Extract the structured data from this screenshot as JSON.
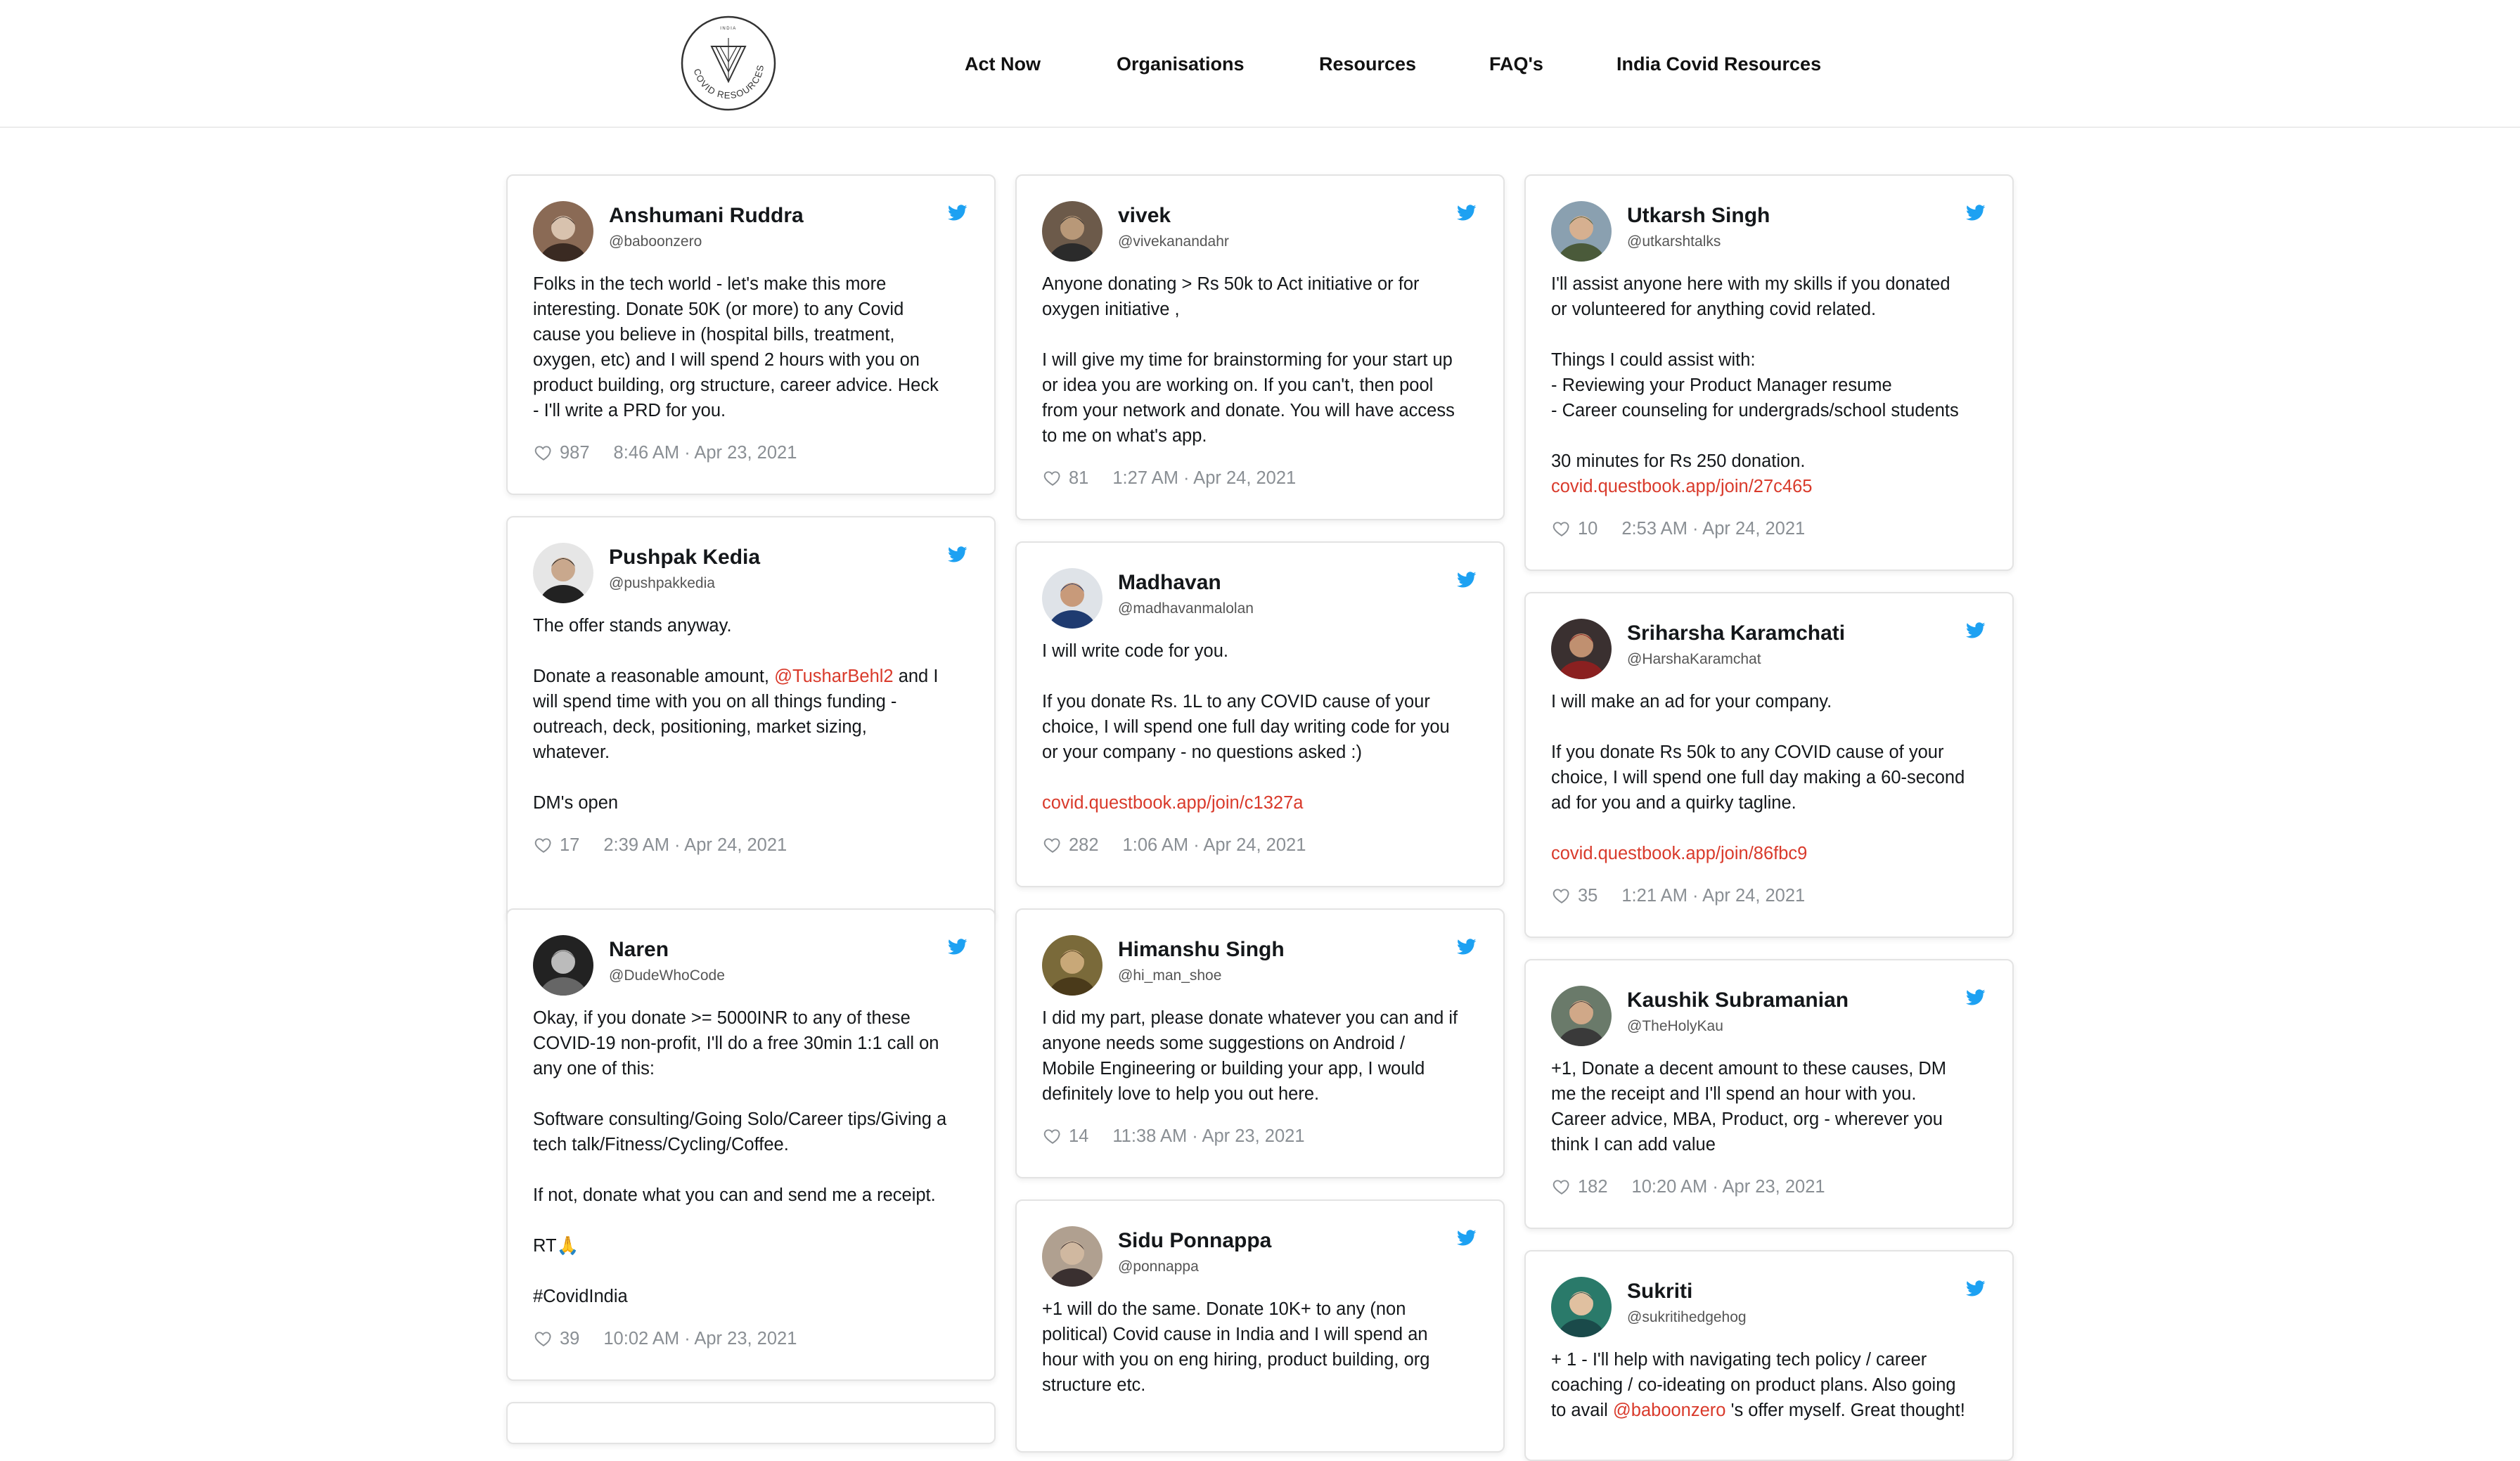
{
  "header": {
    "logo_text_top": "INDIA",
    "logo_text_ring": "COVID RESOURCES",
    "nav": [
      {
        "label": "Act Now"
      },
      {
        "label": "Organisations"
      },
      {
        "label": "Resources"
      },
      {
        "label": "FAQ's"
      },
      {
        "label": "India Covid Resources"
      }
    ]
  },
  "colors": {
    "twitter_blue": "#1da1f2",
    "link_red": "#d93a2b",
    "meta_gray": "#8a8f94"
  },
  "tweets": [
    {
      "name": "Anshumani Ruddra",
      "handle": "@baboonzero",
      "lines": [
        {
          "t": "Folks in the tech world - let's make this more"
        },
        {
          "t": "interesting. Donate 50K (or more) to any Covid"
        },
        {
          "t": "cause you believe in (hospital bills, treatment,"
        },
        {
          "t": "oxygen, etc) and I will spend 2 hours with you on"
        },
        {
          "t": "product building, org structure, career advice. Heck"
        },
        {
          "t": "- I'll write a PRD for you."
        }
      ],
      "likes": "987",
      "time": "8:46 AM · Apr 23, 2021"
    },
    {
      "name": "Pushpak Kedia",
      "handle": "@pushpakkedia",
      "lines": [
        {
          "t": "The offer stands anyway."
        },
        {
          "t": ""
        },
        {
          "t": "Donate a reasonable amount, ",
          "link": "@TusharBehl2",
          "after": " and I"
        },
        {
          "t": "will spend time with you on all things funding -"
        },
        {
          "t": "outreach, deck, positioning, market sizing,"
        },
        {
          "t": "whatever."
        },
        {
          "t": ""
        },
        {
          "t": "DM's open"
        }
      ],
      "likes": "17",
      "time": "2:39 AM · Apr 24, 2021"
    },
    {
      "name": "Naren",
      "handle": "@DudeWhoCode",
      "lines": [
        {
          "t": "Okay, if you donate >= 5000INR to any of these"
        },
        {
          "t": "COVID-19 non-profit, I'll do a free 30min 1:1 call on"
        },
        {
          "t": "any one of this:"
        },
        {
          "t": ""
        },
        {
          "t": "Software consulting/Going Solo/Career tips/Giving a"
        },
        {
          "t": "tech talk/Fitness/Cycling/Coffee."
        },
        {
          "t": ""
        },
        {
          "t": "If not, donate what you can and send me a receipt."
        },
        {
          "t": ""
        },
        {
          "t": "RT🙏"
        },
        {
          "t": ""
        },
        {
          "t": "#CovidIndia"
        }
      ],
      "likes": "39",
      "time": "10:02 AM · Apr 23, 2021"
    },
    {
      "name": "vivek",
      "handle": "@vivekanandahr",
      "lines": [
        {
          "t": "Anyone donating > Rs 50k to Act initiative or for"
        },
        {
          "t": "oxygen initiative ,"
        },
        {
          "t": ""
        },
        {
          "t": "I will give my time for brainstorming for your start up"
        },
        {
          "t": "or idea you are working on. If you can't, then pool"
        },
        {
          "t": "from your network and donate. You will have access"
        },
        {
          "t": "to me on what's app."
        }
      ],
      "likes": "81",
      "time": "1:27 AM · Apr 24, 2021"
    },
    {
      "name": "Madhavan",
      "handle": "@madhavanmalolan",
      "lines": [
        {
          "t": "I will write code for you."
        },
        {
          "t": ""
        },
        {
          "t": "If you donate Rs. 1L to any COVID cause of your"
        },
        {
          "t": "choice, I will spend one full day writing code for you"
        },
        {
          "t": "or your company - no questions asked :)"
        },
        {
          "t": ""
        },
        {
          "t": "",
          "link": "covid.questbook.app/join/c1327a",
          "after": ""
        }
      ],
      "likes": "282",
      "time": "1:06 AM · Apr 24, 2021"
    },
    {
      "name": "Himanshu Singh",
      "handle": "@hi_man_shoe",
      "lines": [
        {
          "t": "I did my part, please donate whatever you can and if"
        },
        {
          "t": "anyone needs some suggestions on Android /"
        },
        {
          "t": "Mobile Engineering or building your app, I would"
        },
        {
          "t": "definitely love to help you out here."
        }
      ],
      "likes": "14",
      "time": "11:38 AM · Apr 23, 2021"
    },
    {
      "name": "Sidu Ponnappa",
      "handle": "@ponnappa",
      "lines": [
        {
          "t": "+1 will do the same. Donate 10K+ to any (non"
        },
        {
          "t": "political) Covid cause in India and I will spend an"
        },
        {
          "t": "hour with you on eng hiring, product building, org"
        },
        {
          "t": "structure etc."
        }
      ],
      "likes": "",
      "time": ""
    },
    {
      "name": "Utkarsh Singh",
      "handle": "@utkarshtalks",
      "lines": [
        {
          "t": "I'll assist anyone here with my skills if you donated"
        },
        {
          "t": "or volunteered for anything covid related."
        },
        {
          "t": ""
        },
        {
          "t": "Things I could assist with:"
        },
        {
          "t": "- Reviewing your Product Manager resume"
        },
        {
          "t": "- Career counseling for undergrads/school students"
        },
        {
          "t": ""
        },
        {
          "t": "30 minutes for Rs 250 donation."
        },
        {
          "t": "",
          "link": "covid.questbook.app/join/27c465",
          "after": ""
        }
      ],
      "likes": "10",
      "time": "2:53 AM · Apr 24, 2021"
    },
    {
      "name": "Sriharsha Karamchati",
      "handle": "@HarshaKaramchat",
      "lines": [
        {
          "t": "I will make an ad for your company."
        },
        {
          "t": ""
        },
        {
          "t": "If you donate Rs 50k to any COVID cause of your"
        },
        {
          "t": "choice, I will spend one full day making a 60-second"
        },
        {
          "t": "ad for you and a quirky tagline."
        },
        {
          "t": ""
        },
        {
          "t": "",
          "link": "covid.questbook.app/join/86fbc9",
          "after": ""
        }
      ],
      "likes": "35",
      "time": "1:21 AM · Apr 24, 2021"
    },
    {
      "name": "Kaushik Subramanian",
      "handle": "@TheHolyKau",
      "lines": [
        {
          "t": "+1, Donate a decent amount to these causes, DM"
        },
        {
          "t": "me the receipt and I'll spend an hour with you."
        },
        {
          "t": "Career advice, MBA, Product, org - wherever you"
        },
        {
          "t": "think I can add value"
        }
      ],
      "likes": "182",
      "time": "10:20 AM · Apr 23, 2021"
    },
    {
      "name": "Sukriti",
      "handle": "@sukritihedgehog",
      "lines": [
        {
          "t": "+ 1 - I'll help with navigating tech policy / career"
        },
        {
          "t": "coaching / co-ideating on product plans. Also going"
        },
        {
          "t": "to avail ",
          "link": "@baboonzero",
          "after": " 's offer myself. Great thought!"
        }
      ],
      "likes": "",
      "time": ""
    }
  ]
}
